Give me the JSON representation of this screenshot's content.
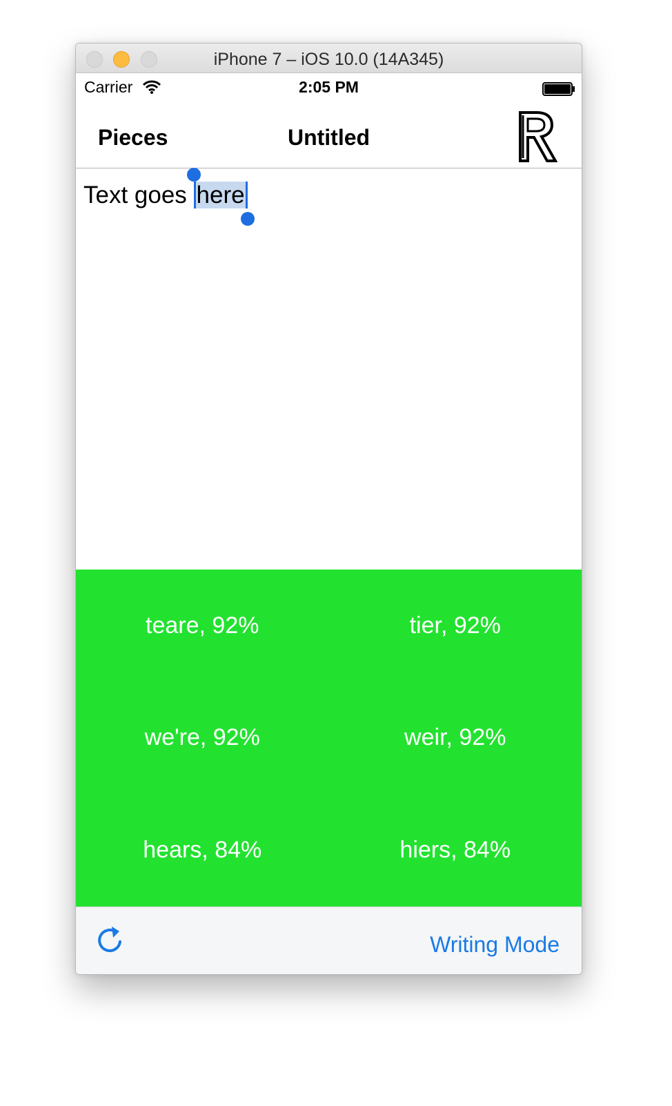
{
  "window": {
    "title": "iPhone 7 – iOS 10.0 (14A345)"
  },
  "status_bar": {
    "carrier": "Carrier",
    "time": "2:05 PM",
    "wifi_icon": "wifi-icon",
    "battery_icon": "battery-icon"
  },
  "nav": {
    "left_button": "Pieces",
    "title": "Untitled",
    "right_icon": "logo-r-icon"
  },
  "editor": {
    "text_before": "Text goes ",
    "selected": "here"
  },
  "suggestions": {
    "background": "#22e22f",
    "items": [
      {
        "label": "teare, 92%"
      },
      {
        "label": "tier, 92%"
      },
      {
        "label": "we're, 92%"
      },
      {
        "label": "weir, 92%"
      },
      {
        "label": "hears, 84%"
      },
      {
        "label": "hiers, 84%"
      }
    ]
  },
  "toolbar": {
    "refresh_icon": "refresh-icon",
    "mode_button": "Writing Mode",
    "accent": "#1a7ae6"
  }
}
